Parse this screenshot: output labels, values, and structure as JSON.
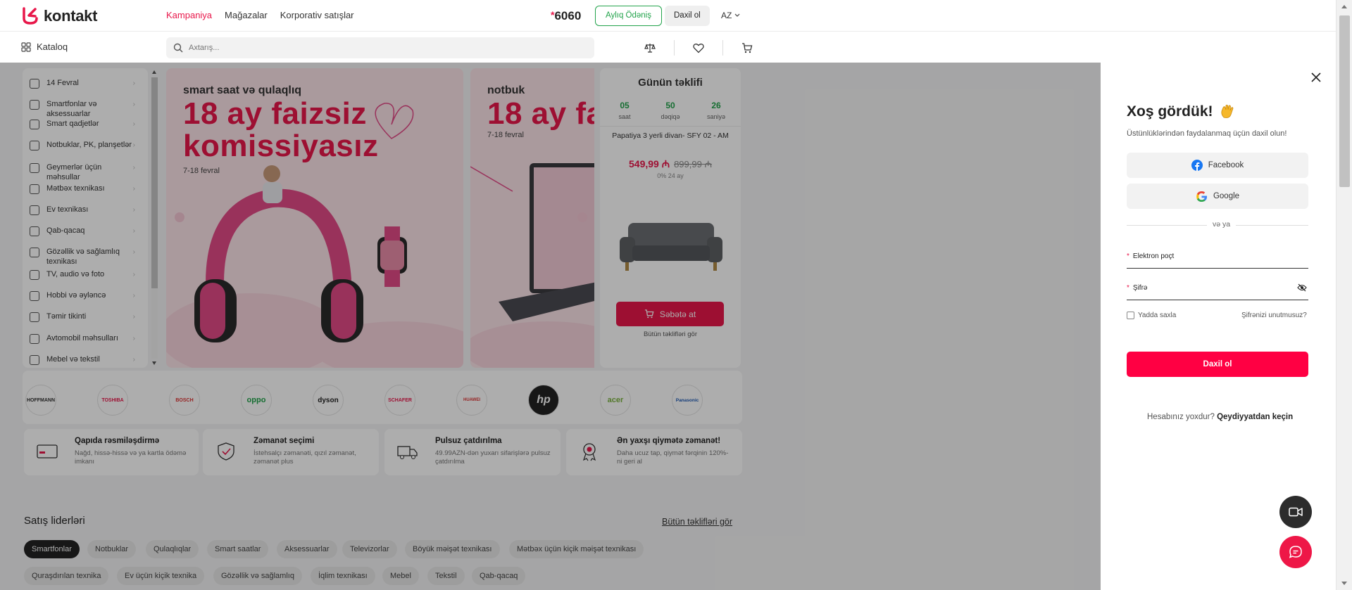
{
  "header": {
    "logo_text": "kontakt",
    "nav": [
      "Kampaniya",
      "Mağazalar",
      "Korporativ satışlar"
    ],
    "hotline_star": "*",
    "hotline": "6060",
    "monthly_button": "Aylıq Ödəniş",
    "login_button": "Daxil ol",
    "language": "AZ"
  },
  "subheader": {
    "catalog_label": "Kataloq",
    "search_placeholder": "Axtarış..."
  },
  "sidebar": {
    "items": [
      "14 Fevral",
      "Smartfonlar və aksessuarlar",
      "Smart qadjetlər",
      "Notbuklar, PK, planşetlər",
      "Geymerlər üçün məhsullar",
      "Mətbəx texnikası",
      "Ev texnikası",
      "Qab-qacaq",
      "Gözəllik və sağlamlıq texnikası",
      "TV, audio və foto",
      "Hobbi və əyləncə",
      "Təmir tikinti",
      "Avtomobil məhsulları",
      "Mebel və tekstil"
    ]
  },
  "banners": [
    {
      "subtitle": "smart saat və qulaqlıq",
      "headline": "18 ay faizsiz komissiyasız",
      "date": "7-18 fevral"
    },
    {
      "subtitle": "notbuk",
      "headline": "18 ay fa",
      "date": "7-18 fevral"
    }
  ],
  "deal": {
    "title": "Günün təklifi",
    "timer": [
      {
        "value": "05",
        "unit": "saat"
      },
      {
        "value": "50",
        "unit": "dəqiqə"
      },
      {
        "value": "26",
        "unit": "saniyə"
      }
    ],
    "product_name": "Papatiya 3 yerli divan- SFY 02 - AM",
    "price_new": "549,99 ₼",
    "price_old": "899,99 ₼",
    "installment": "0% 24 ay",
    "cart_button": "Səbətə at",
    "all_offers": "Bütün təklifləri gör"
  },
  "brands": [
    "HOFFMANN",
    "TOSHIBA",
    "BOSCH",
    "oppo",
    "dyson",
    "SCHAFER",
    "HUAWEI",
    "hp",
    "acer",
    "Panasonic"
  ],
  "features": [
    {
      "title": "Qapıda rəsmiləşdirmə",
      "desc": "Nağd, hissə-hissə və ya kartla ödəmə imkanı"
    },
    {
      "title": "Zəmanət seçimi",
      "desc": "İstehsalçı zəmanəti, qızıl zəmanət, zəmanət plus"
    },
    {
      "title": "Pulsuz çatdırılma",
      "desc": "49.99AZN-dən yuxarı sifarişlərə pulsuz çatdırılma"
    },
    {
      "title": "Ən yaxşı qiymətə zəmanət!",
      "desc": "Daha ucuz tap, qiymət fərqinin 120%-ni geri al"
    }
  ],
  "leaders": {
    "title": "Satış liderləri",
    "all_link": "Bütün təklifləri gör",
    "chips_row1": [
      "Smartfonlar",
      "Notbuklar",
      "Qulaqlıqlar",
      "Smart saatlar",
      "Aksessuarlar",
      "Televizorlar",
      "Böyük məişət texnikası",
      "Mətbəx üçün kiçik məişət texnikası"
    ],
    "chips_row2": [
      "Quraşdırılan texnika",
      "Ev üçün kiçik texnika",
      "Gözəllik və sağlamlıq",
      "İqlim texnikası",
      "Mebel",
      "Tekstil",
      "Qab-qacaq"
    ]
  },
  "login": {
    "title": "Xoş gördük!",
    "subtitle": "Üstünlüklərindən faydalanmaq üçün daxil olun!",
    "facebook": "Facebook",
    "google": "Google",
    "or": "və ya",
    "email_label": "Elektron poçt",
    "password_label": "Şifrə",
    "required_mark": "*",
    "remember": "Yadda saxla",
    "forgot": "Şifrənizi unutmusuz?",
    "submit": "Daxil ol",
    "no_account": "Hesabınız yoxdur?",
    "register": "Qeydiyyatdan keçin"
  },
  "colors": {
    "brand_red": "#e8174a",
    "submit_red": "#ff0043",
    "green": "#22a34b"
  }
}
